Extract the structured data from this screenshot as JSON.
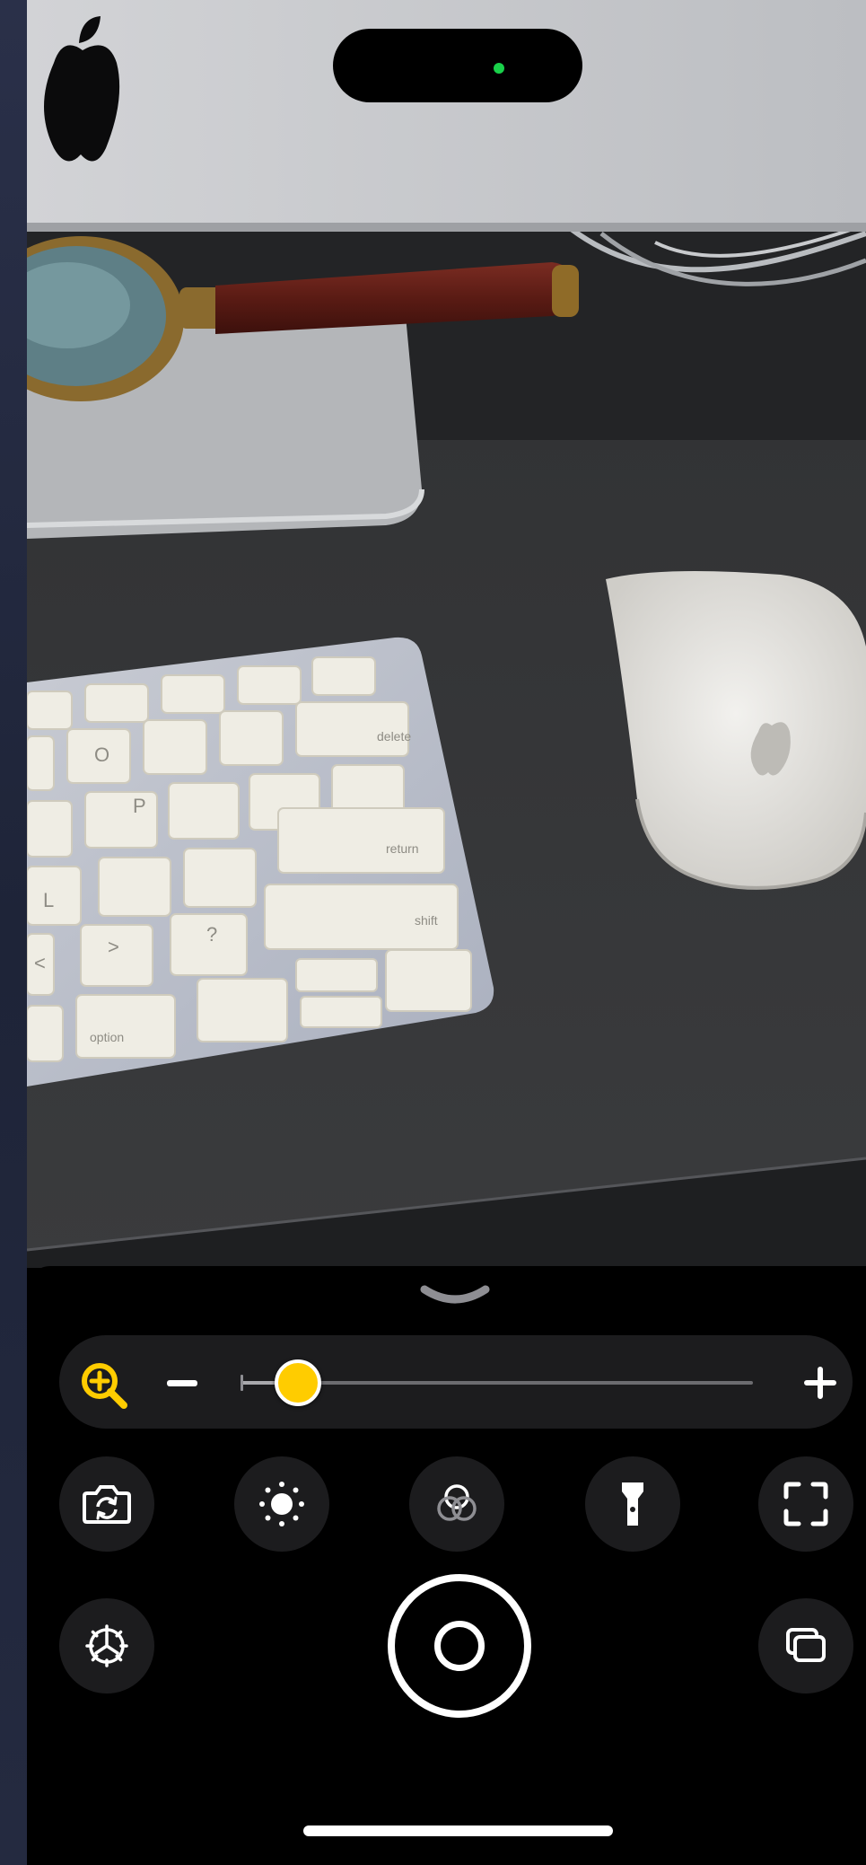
{
  "app": "Magnifier",
  "status": {
    "camera_indicator_color": "#19d14a"
  },
  "viewfinder": {
    "keyboard_keys": [
      "option",
      "shift",
      "return",
      "delete",
      "P",
      "O",
      "L",
      "?",
      ">",
      "<"
    ],
    "scene": "live-camera-feed"
  },
  "panel": {
    "collapse_icon": "chevron-down-icon",
    "zoom": {
      "icon": "zoom-in-icon",
      "minus_icon": "minus-icon",
      "plus_icon": "plus-icon",
      "level": 0.11,
      "accent": "#ffcc00"
    },
    "controls_row": [
      {
        "id": "flip-camera",
        "icon": "camera-flip-icon"
      },
      {
        "id": "brightness",
        "icon": "brightness-icon"
      },
      {
        "id": "filters",
        "icon": "filters-icon"
      },
      {
        "id": "flashlight",
        "icon": "flashlight-icon"
      },
      {
        "id": "detection-mode",
        "icon": "viewfinder-brackets-icon"
      }
    ],
    "bottom_row": [
      {
        "id": "settings",
        "icon": "gear-icon"
      },
      {
        "id": "shutter",
        "icon": "shutter-icon"
      },
      {
        "id": "multi-capture",
        "icon": "multi-window-icon"
      }
    ]
  }
}
